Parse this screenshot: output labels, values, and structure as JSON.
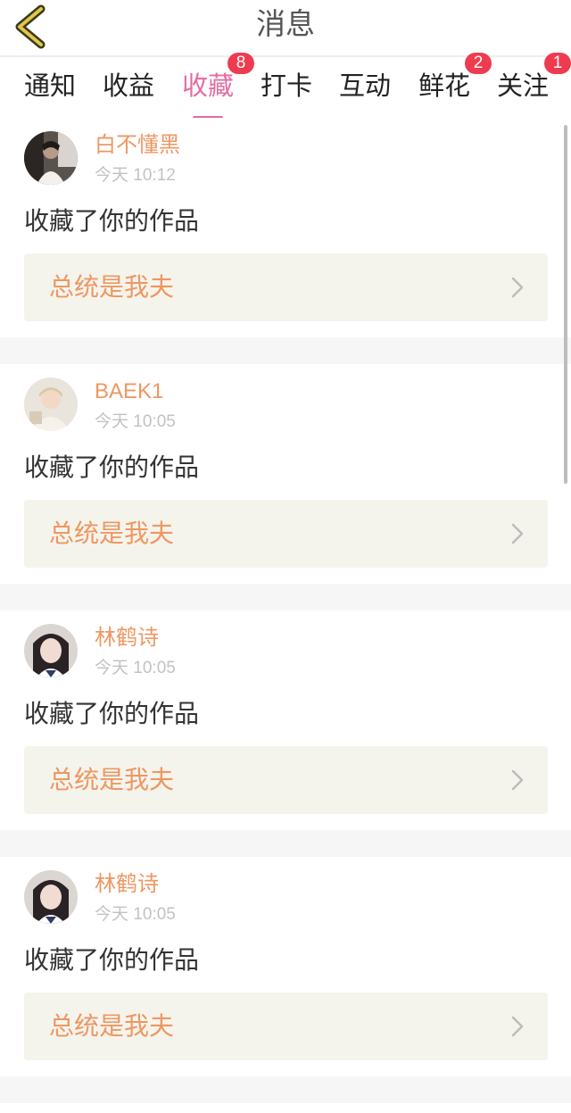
{
  "header": {
    "title": "消息"
  },
  "tabs": [
    {
      "label": "通知",
      "badge": ""
    },
    {
      "label": "收益",
      "badge": ""
    },
    {
      "label": "收藏",
      "badge": "8",
      "active": true
    },
    {
      "label": "打卡",
      "badge": ""
    },
    {
      "label": "互动",
      "badge": ""
    },
    {
      "label": "鲜花",
      "badge": "2"
    },
    {
      "label": "关注",
      "badge": "1"
    }
  ],
  "messages": [
    {
      "user": "白不懂黑",
      "time": "今天 10:12",
      "action": "收藏了你的作品",
      "work": "总统是我夫"
    },
    {
      "user": "BAEK1",
      "time": "今天 10:05",
      "action": "收藏了你的作品",
      "work": "总统是我夫"
    },
    {
      "user": "林鹤诗",
      "time": "今天 10:05",
      "action": "收藏了你的作品",
      "work": "总统是我夫"
    },
    {
      "user": "林鹤诗",
      "time": "今天 10:05",
      "action": "收藏了你的作品",
      "work": "总统是我夫"
    }
  ],
  "colors": {
    "accent": "#e36da3",
    "username": "#ee9762",
    "badge": "#ef3b4f",
    "link_bg": "#f5f4ec"
  }
}
